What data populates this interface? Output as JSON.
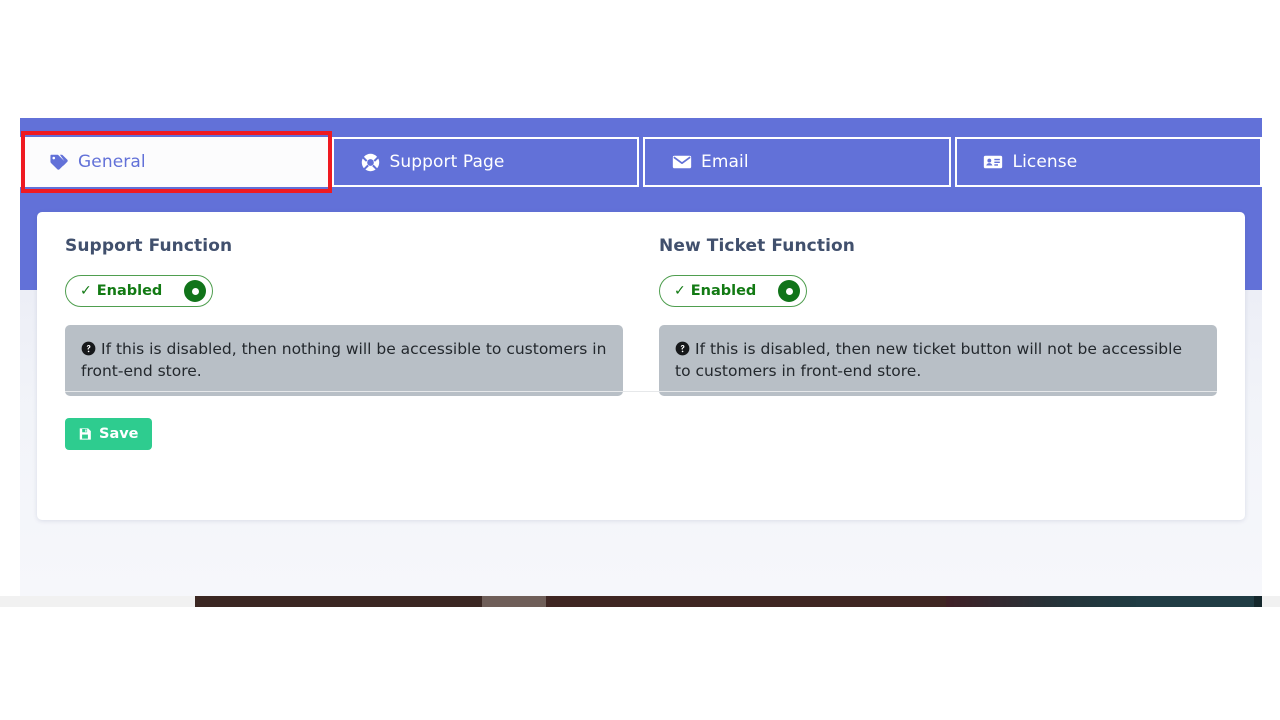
{
  "tabs": [
    {
      "label": "General",
      "icon": "tag-icon",
      "active": true
    },
    {
      "label": "Support Page",
      "icon": "lifering-icon",
      "active": false
    },
    {
      "label": "Email",
      "icon": "envelope-icon",
      "active": false
    },
    {
      "label": "License",
      "icon": "id-card-icon",
      "active": false
    }
  ],
  "panels": [
    {
      "title": "Support Function",
      "toggle": {
        "check": "✓",
        "label": "Enabled",
        "state": "on"
      },
      "help": "If this is disabled, then nothing will be accessible to customers in front-end store."
    },
    {
      "title": "New Ticket Function",
      "toggle": {
        "check": "✓",
        "label": "Enabled",
        "state": "on"
      },
      "help": "If this is disabled, then new ticket button will not be accessible to customers in front-end store."
    }
  ],
  "save": {
    "label": "Save",
    "icon": "floppy-disk-icon"
  },
  "annotation": {
    "type": "highlight-rectangle",
    "target": "General",
    "color": "#ef1a21"
  },
  "colors": {
    "header_purple": "#6271d8",
    "active_tab_text": "#6271d8",
    "heading": "#41506d",
    "toggle_green": "#127a13",
    "toggle_knob": "#11741a",
    "alert_bg": "#b8bfc6",
    "save_green": "#2ecc8f",
    "annotation_red": "#ef1a21"
  }
}
